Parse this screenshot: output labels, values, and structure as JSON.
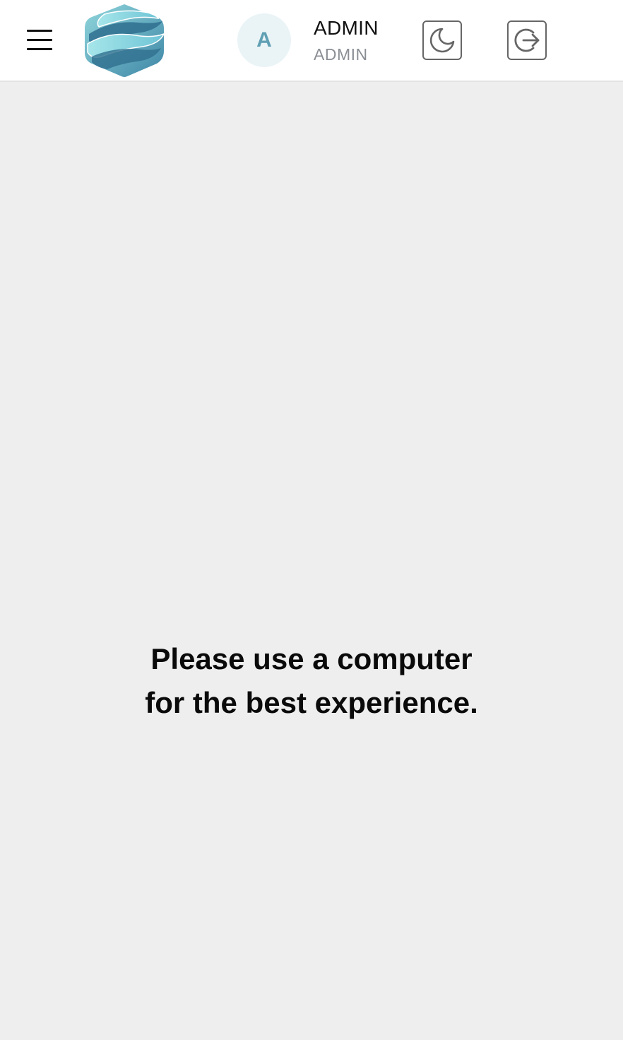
{
  "header": {
    "menu_icon": "hamburger-menu-icon",
    "logo_icon": "brand-logo",
    "user": {
      "avatar_initial": "A",
      "name": "ADMIN",
      "role": "ADMIN"
    },
    "theme_toggle_icon": "moon-icon",
    "logout_icon": "logout-icon"
  },
  "main": {
    "message": "Please use a computer for the best experience."
  },
  "colors": {
    "background": "#eeeeee",
    "header_background": "#ffffff",
    "accent": "#5f9fb3",
    "avatar_background": "#eaf4f6"
  }
}
